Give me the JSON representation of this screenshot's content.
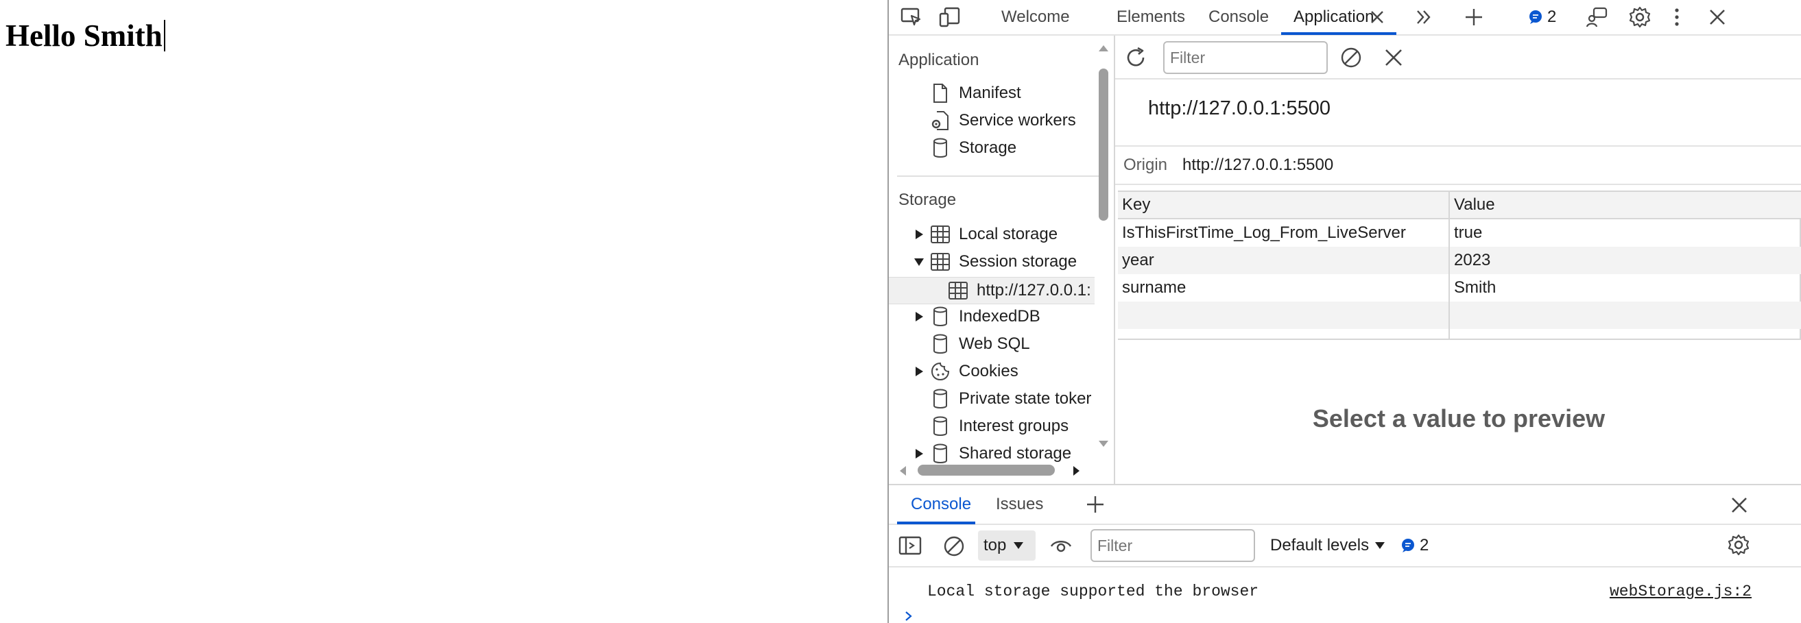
{
  "page": {
    "heading": "Hello Smith"
  },
  "devtools": {
    "tabs": [
      "Welcome",
      "Elements",
      "Console",
      "Application"
    ],
    "message_count": "2",
    "sidebar": {
      "application_section": "Application",
      "application_items": [
        "Manifest",
        "Service workers",
        "Storage"
      ],
      "storage_section": "Storage",
      "storage_items": {
        "local_storage": "Local storage",
        "session_storage": "Session storage",
        "session_origin": "http://127.0.0.1:",
        "indexeddb": "IndexedDB",
        "websql": "Web SQL",
        "cookies": "Cookies",
        "private_state": "Private state toker",
        "interest_groups": "Interest groups",
        "shared_storage": "Shared storage"
      }
    },
    "storage_panel": {
      "filter_placeholder": "Filter",
      "title_url": "http://127.0.0.1:5500",
      "origin_label": "Origin",
      "origin_value": "http://127.0.0.1:5500",
      "columns": [
        "Key",
        "Value"
      ],
      "rows": [
        {
          "key": "IsThisFirstTime_Log_From_LiveServer",
          "value": "true"
        },
        {
          "key": "year",
          "value": "2023"
        },
        {
          "key": "surname",
          "value": "Smith"
        }
      ],
      "preview_placeholder": "Select a value to preview"
    },
    "drawer": {
      "tabs": [
        "Console",
        "Issues"
      ],
      "context": "top",
      "filter_placeholder": "Filter",
      "levels": "Default levels",
      "message_count": "2",
      "log_message": "Local storage supported the browser",
      "log_source": "webStorage.js:2"
    },
    "colors": {
      "accent": "#0b57d0",
      "text": "#1f1f1f",
      "muted": "#474747"
    }
  }
}
